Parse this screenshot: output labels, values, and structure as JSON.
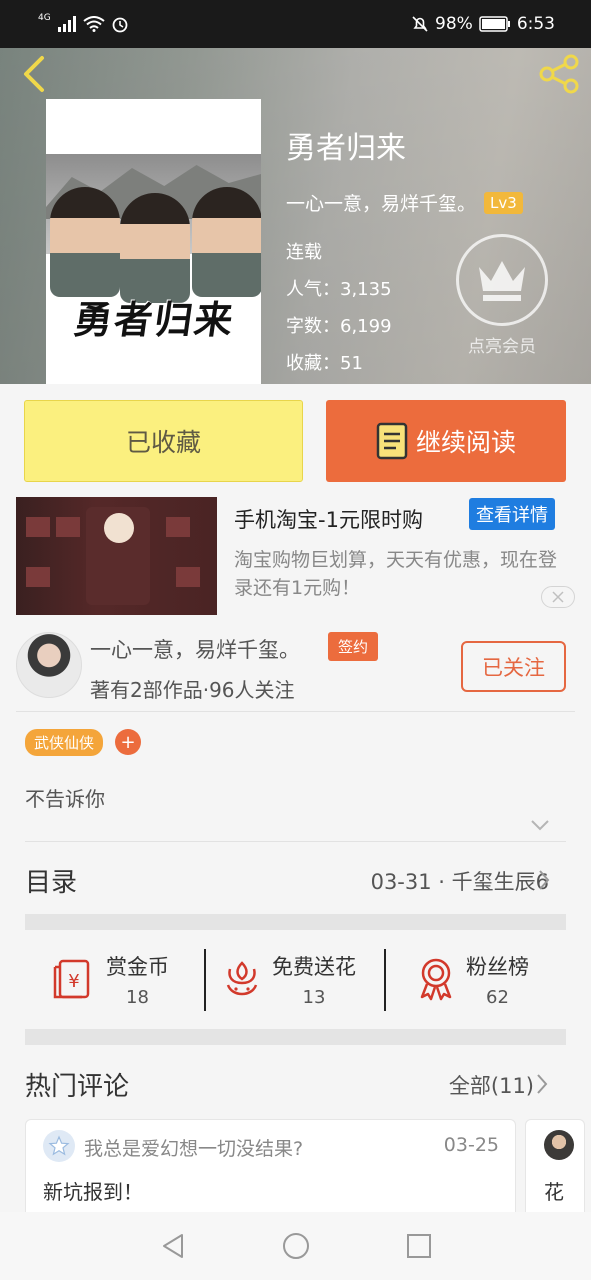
{
  "status_bar": {
    "network": "4G",
    "battery": "98%",
    "time": "6:53"
  },
  "book": {
    "title": "勇者归来",
    "cover_text": "勇者归来",
    "author": "一心一意，易烊千玺。",
    "author_level": "Lv3",
    "status": "连载",
    "popularity": "人气：3,135",
    "word_count": "字数：6,199",
    "favorites": "收藏：51",
    "vip_label": "点亮会员"
  },
  "actions": {
    "favorited_label": "已收藏",
    "continue_label": "继续阅读"
  },
  "ad": {
    "title": "手机淘宝-1元限时购",
    "detail_label": "查看详情",
    "description": "淘宝购物巨划算，天天有优惠，现在登录还有1元购！"
  },
  "author_card": {
    "name": "一心一意，易烊千玺。",
    "badge": "签约",
    "stats": "著有2部作品·96人关注",
    "follow_label": "已关注"
  },
  "tags": {
    "genre": "武侠仙侠",
    "add": "+"
  },
  "description": "不告诉你",
  "catalog": {
    "label": "目录",
    "latest": "03-31 · 千玺生辰6"
  },
  "stats": [
    {
      "label": "赏金币",
      "value": "18"
    },
    {
      "label": "免费送花",
      "value": "13"
    },
    {
      "label": "粉丝榜",
      "value": "62"
    }
  ],
  "comments": {
    "section_title": "热门评论",
    "all_label": "全部(11)",
    "items": [
      {
        "user": "我总是爱幻想一切没结果?",
        "date": "03-25",
        "text": "新坑报到！"
      },
      {
        "text": "花"
      }
    ]
  },
  "colors": {
    "accent": "#ec6c3d",
    "favorite_bg": "#fbf07f",
    "level_badge": "#f2b83b",
    "ad_button": "#1f7de0",
    "tag": "#f4a53a"
  }
}
